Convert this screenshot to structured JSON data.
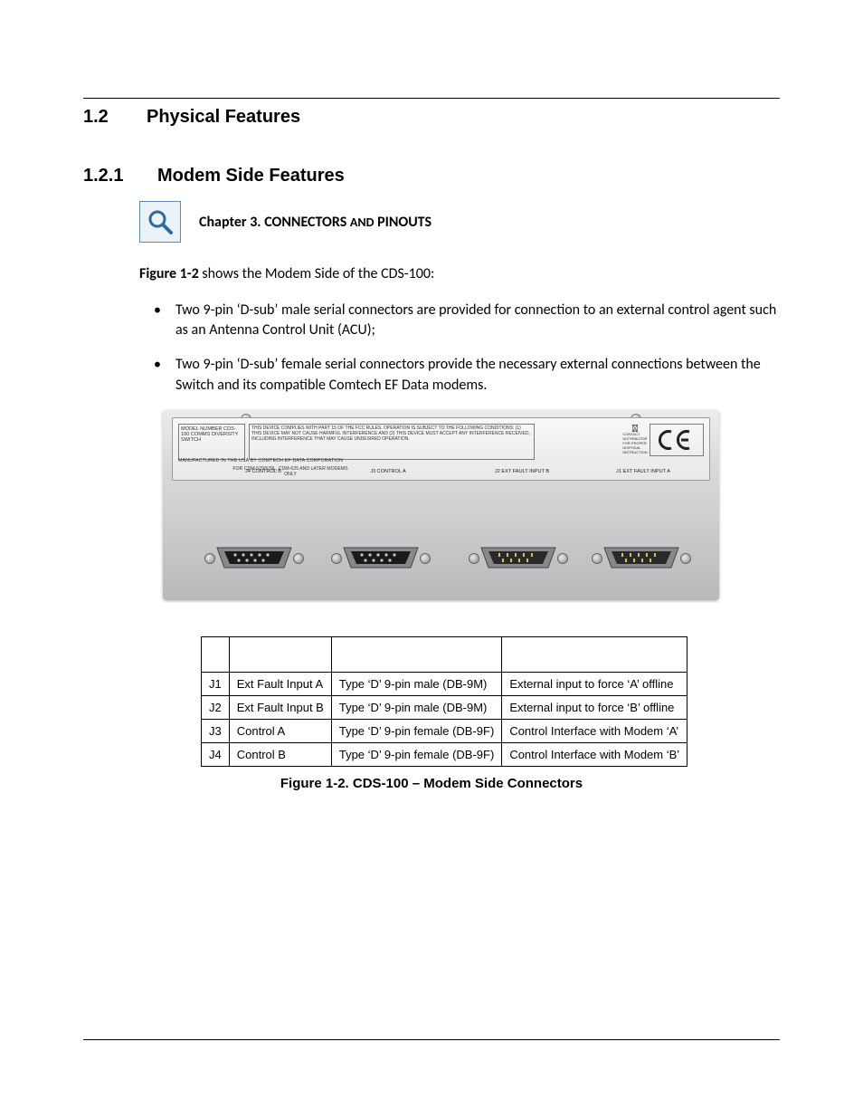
{
  "section": {
    "number": "1.2",
    "title": "Physical Features"
  },
  "subsection": {
    "number": "1.2.1",
    "title": "Modem Side Features"
  },
  "callout": {
    "prefix": "Chapter 3. CONNECTORS",
    "and": "AND",
    "suffix": "PINOUTS"
  },
  "intro": {
    "figref": "Figure 1-2",
    "text": " shows the Modem Side of the CDS-100:"
  },
  "bullets": [
    "Two 9-pin ‘D-sub’ male serial connectors are provided for connection to an external control agent such as an Antenna Control Unit (ACU);",
    "Two 9-pin ‘D-sub’ female serial connectors provide the necessary external connections between the Switch and its compatible Comtech EF Data modems."
  ],
  "device_labels": {
    "model": "MODEL NUMBER\nCDS-100\nCOMMS DIVERSITY\nSWITCH",
    "fcc": "THIS DEVICE COMPLIES WITH PART 15 OF THE FCC RULES.  OPERATION IS SUBJECT TO THE FOLLOWING CONDITIONS:\n(1) THIS DEVICE MAY NOT CAUSE HARMFUL INTERFERENCE AND\n(2) THIS DEVICE MUST ACCEPT ANY INTERFERENCE RECEIVED, INCLUDING INTERFERENCE THAT MAY CAUSE UNDESIRED OPERATION.",
    "mfr": "MANUFACTURED IN THE USA BY COMTECH EF DATA CORPORATION",
    "modems_only": "FOR CDM-570/570L, CDM-625\nAND LATER MODEMS ONLY",
    "weee_note": "CONTACT DISTRIBUTOR\nFOR PROPER DISPOSAL\nINSTRUCTION",
    "j4": "J4\nCONTROL B",
    "j3": "J3\nCONTROL A",
    "j2": "J2\nEXT FAULT INPUT B",
    "j1": "J1\nEXT FAULT INPUT A"
  },
  "table": {
    "headers": [
      "",
      "",
      "",
      ""
    ],
    "rows": [
      {
        "id": "J1",
        "name": "Ext Fault Input A",
        "type": "Type ‘D’ 9-pin male (DB-9M)",
        "desc": "External input to force ‘A’ offline"
      },
      {
        "id": "J2",
        "name": "Ext Fault Input B",
        "type": "Type ‘D’ 9-pin male (DB-9M)",
        "desc": "External input to force ‘B’ offline"
      },
      {
        "id": "J3",
        "name": "Control A",
        "type": "Type ‘D’ 9-pin female (DB-9F)",
        "desc": "Control Interface with Modem ‘A’"
      },
      {
        "id": "J4",
        "name": "Control B",
        "type": "Type ‘D’ 9-pin female (DB-9F)",
        "desc": "Control Interface with Modem ‘B’"
      }
    ]
  },
  "figure_caption": "Figure 1-2. CDS-100 – Modem Side Connectors"
}
